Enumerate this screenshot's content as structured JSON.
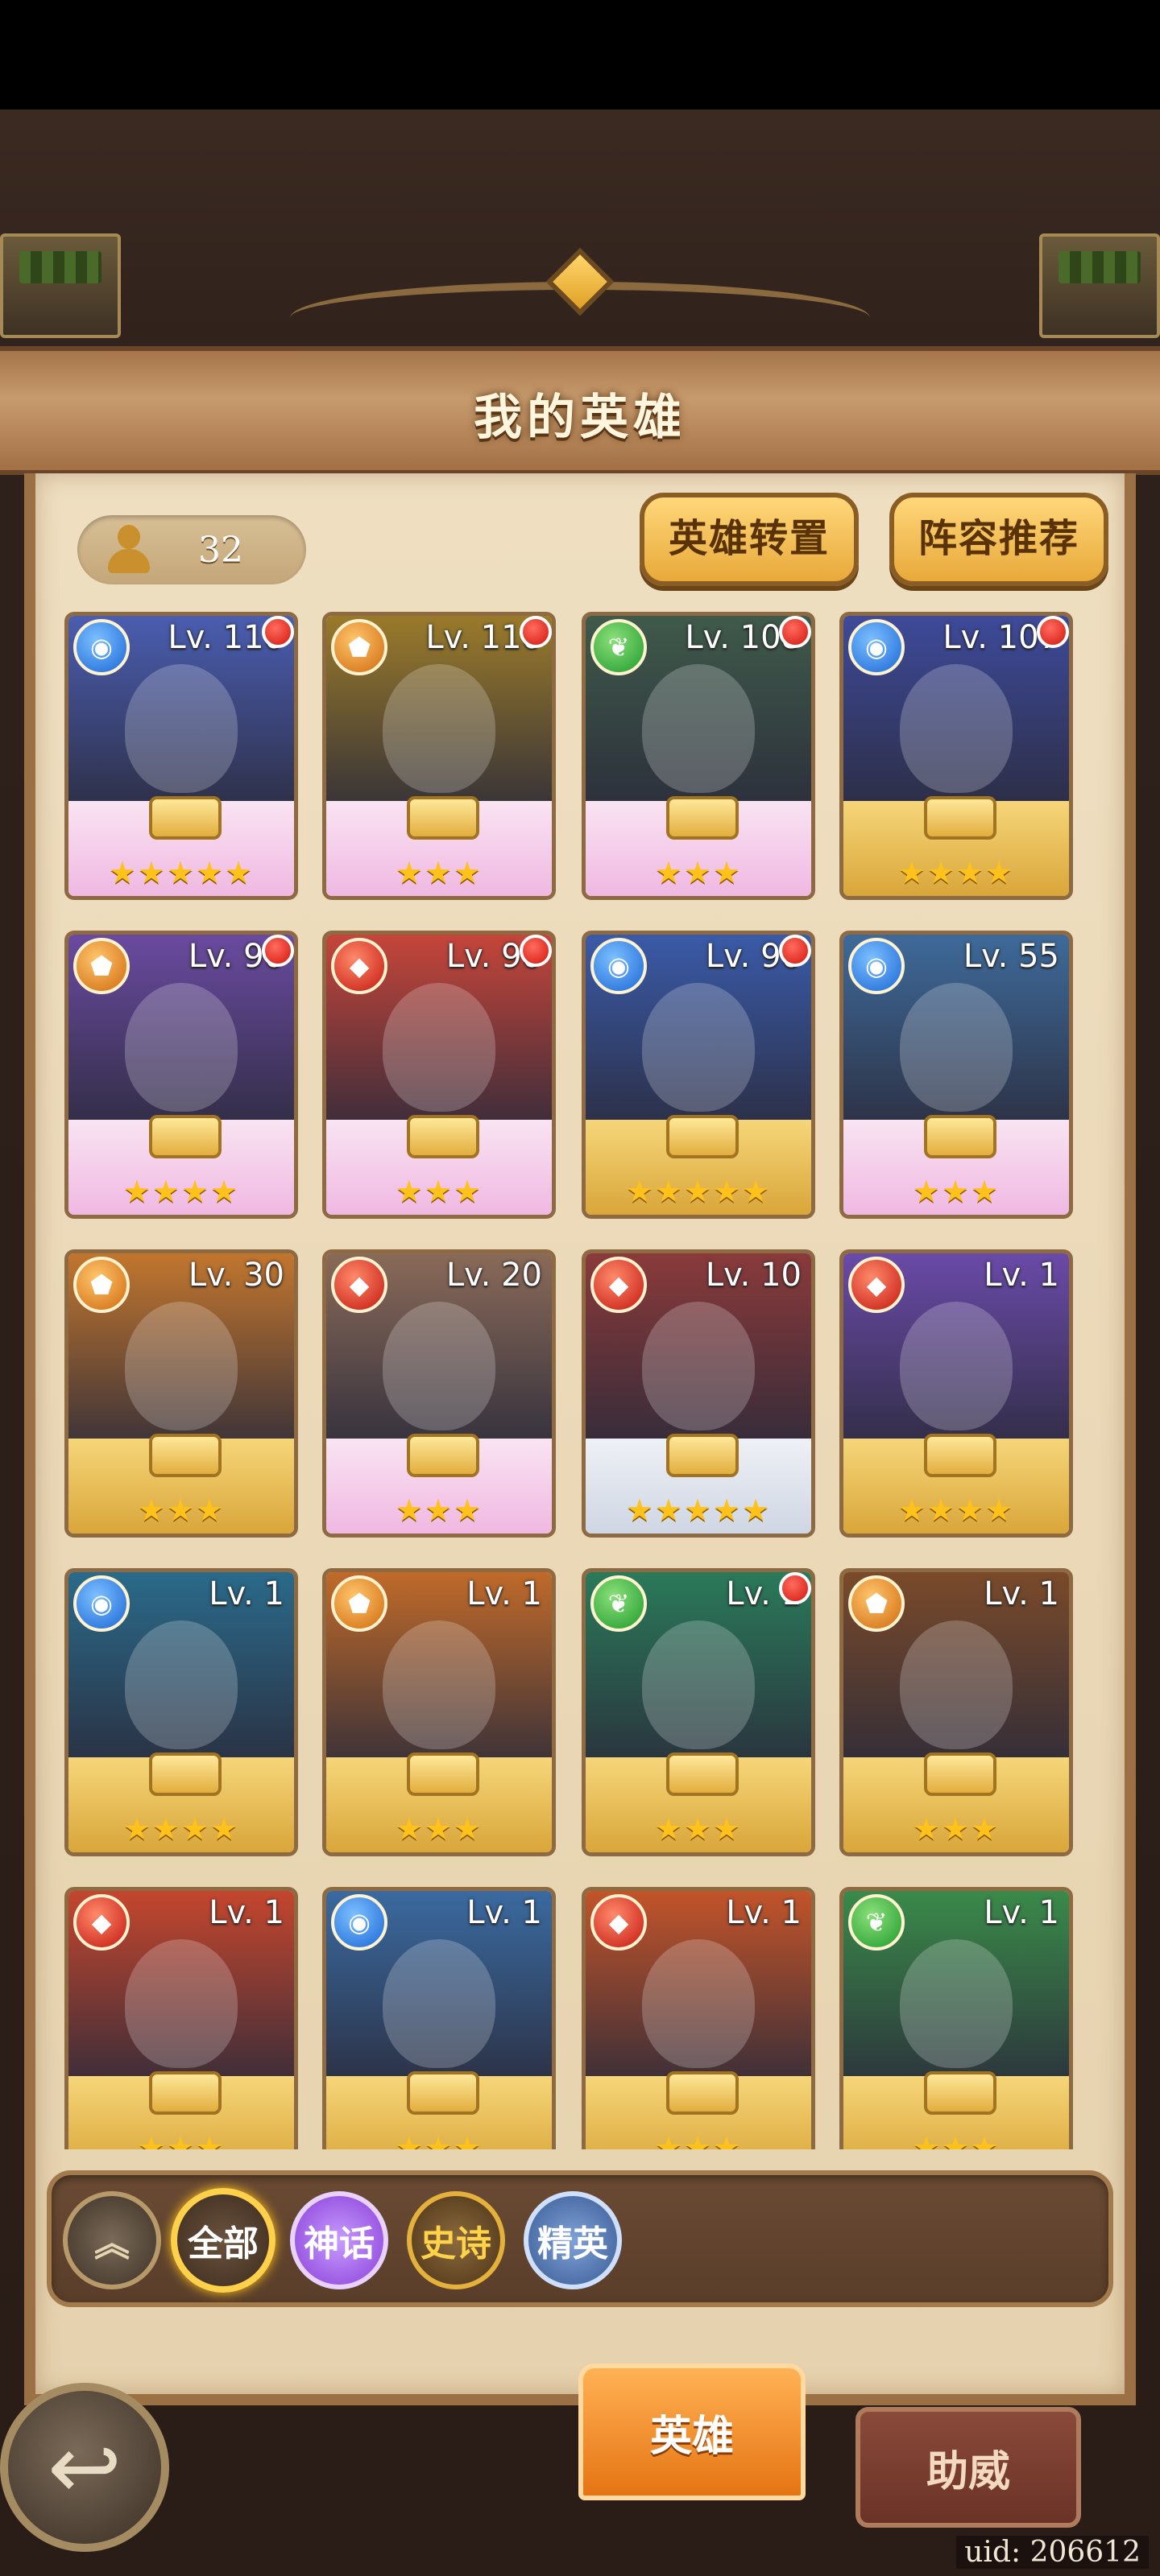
{
  "page_title": "我的英雄",
  "hero_count": "32",
  "top_buttons": {
    "transfer": "英雄转置",
    "recommend": "阵容推荐"
  },
  "heroes": [
    {
      "level": "Lv. 110",
      "element": "water",
      "stars": "★★★★★",
      "frame": "pink",
      "notify": true,
      "bg": "#4a5db0"
    },
    {
      "level": "Lv. 110",
      "element": "earth",
      "stars": "★★★",
      "frame": "pink",
      "notify": true,
      "bg": "#9a7a2a"
    },
    {
      "level": "Lv. 108",
      "element": "wood",
      "stars": "★★★",
      "frame": "pink",
      "notify": true,
      "bg": "#3f5a4a"
    },
    {
      "level": "Lv. 107",
      "element": "water",
      "stars": "★★★★",
      "frame": "gold",
      "notify": true,
      "bg": "#3e4a9a"
    },
    {
      "level": "Lv. 90",
      "element": "earth",
      "stars": "★★★★",
      "frame": "pink",
      "notify": true,
      "bg": "#6a4aa0"
    },
    {
      "level": "Lv. 90",
      "element": "fire",
      "stars": "★★★",
      "frame": "pink",
      "notify": true,
      "bg": "#c5453a"
    },
    {
      "level": "Lv. 90",
      "element": "water",
      "stars": "★★★★★",
      "frame": "gold",
      "notify": true,
      "bg": "#3a5aa8"
    },
    {
      "level": "Lv. 55",
      "element": "water",
      "stars": "★★★",
      "frame": "pink",
      "notify": false,
      "bg": "#3e6a9a"
    },
    {
      "level": "Lv. 30",
      "element": "earth",
      "stars": "★★★",
      "frame": "gold",
      "notify": false,
      "bg": "#c2762e"
    },
    {
      "level": "Lv. 20",
      "element": "fire",
      "stars": "★★★",
      "frame": "pink",
      "notify": false,
      "bg": "#8a6a58"
    },
    {
      "level": "Lv. 10",
      "element": "fire",
      "stars": "★★★★★",
      "frame": "silver",
      "notify": false,
      "bg": "#8a3a3a"
    },
    {
      "level": "Lv. 1",
      "element": "fire",
      "stars": "★★★★",
      "frame": "gold",
      "notify": false,
      "bg": "#6a4aa8"
    },
    {
      "level": "Lv. 1",
      "element": "water",
      "stars": "★★★★",
      "frame": "gold",
      "notify": false,
      "bg": "#2a6a8a"
    },
    {
      "level": "Lv. 1",
      "element": "earth",
      "stars": "★★★",
      "frame": "gold",
      "notify": false,
      "bg": "#c06a2a"
    },
    {
      "level": "Lv. 1",
      "element": "wood",
      "stars": "★★★",
      "frame": "gold",
      "notify": true,
      "bg": "#2a7a5a"
    },
    {
      "level": "Lv. 1",
      "element": "earth",
      "stars": "★★★",
      "frame": "gold",
      "notify": false,
      "bg": "#7a4a2a"
    },
    {
      "level": "Lv. 1",
      "element": "fire",
      "stars": "★★★",
      "frame": "gold",
      "notify": false,
      "bg": "#c4462e"
    },
    {
      "level": "Lv. 1",
      "element": "water",
      "stars": "★★★",
      "frame": "gold",
      "notify": false,
      "bg": "#3a6aa0"
    },
    {
      "level": "Lv. 1",
      "element": "fire",
      "stars": "★★★",
      "frame": "gold",
      "notify": false,
      "bg": "#c2542a"
    },
    {
      "level": "Lv. 1",
      "element": "wood",
      "stars": "★★★",
      "frame": "gold",
      "notify": false,
      "bg": "#3a8a4a"
    }
  ],
  "filters": {
    "all": "全部",
    "myth": "神话",
    "epic": "史诗",
    "elite": "精英"
  },
  "tabs": {
    "heroes": "英雄",
    "support": "助威"
  },
  "uid": "uid: 206612",
  "colors": {
    "notify": "#d3160d",
    "accent_orange": "#e57413",
    "gold": "#ffc21a"
  }
}
